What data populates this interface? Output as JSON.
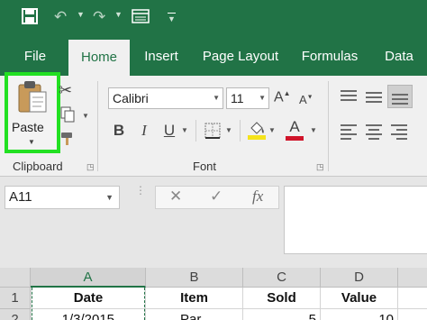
{
  "quick_access": {
    "save_icon": "save-icon",
    "undo_icon": "undo-icon",
    "redo_icon": "redo-icon",
    "form_icon": "form-icon",
    "customize_icon": "customize-caret-icon"
  },
  "tabs": [
    {
      "label": "File"
    },
    {
      "label": "Home"
    },
    {
      "label": "Insert"
    },
    {
      "label": "Page Layout"
    },
    {
      "label": "Formulas"
    },
    {
      "label": "Data"
    }
  ],
  "ribbon": {
    "clipboard": {
      "paste_label": "Paste",
      "group_label": "Clipboard"
    },
    "font": {
      "font_name": "Calibri",
      "font_size": "11",
      "group_label": "Font",
      "bold": "B",
      "italic": "I",
      "underline": "U",
      "font_color_letter": "A",
      "fill_color": "#f5e31b",
      "font_color": "#d0142a"
    }
  },
  "formula_bar": {
    "name_box": "A11",
    "fx": "fx",
    "cancel": "✕",
    "enter": "✓"
  },
  "grid": {
    "columns": [
      "A",
      "B",
      "C",
      "D"
    ],
    "selected_column": "A",
    "rows": [
      {
        "num": "1",
        "cells": [
          "Date",
          "Item",
          "Sold",
          "Value"
        ]
      },
      {
        "num": "2",
        "cells": [
          "1/3/2015",
          "Par",
          "5",
          "10"
        ]
      }
    ]
  },
  "colors": {
    "accent": "#217346",
    "highlight": "#22e022"
  }
}
